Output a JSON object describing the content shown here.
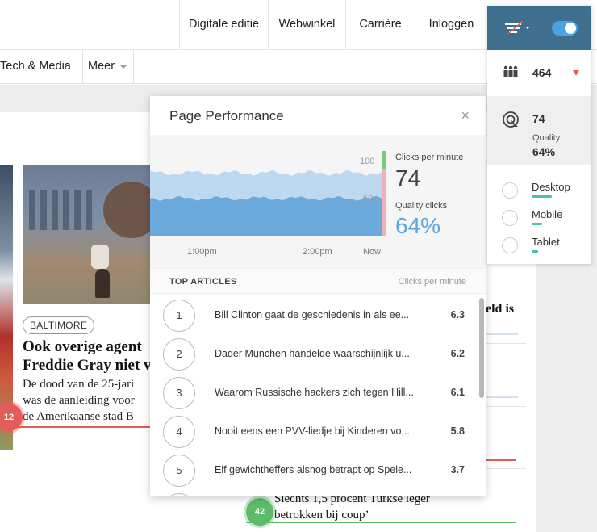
{
  "topnav": {
    "links": [
      "Digitale editie",
      "Webwinkel",
      "Carrière",
      "Inloggen"
    ]
  },
  "secnav": {
    "items": [
      "Tech & Media",
      "Meer"
    ]
  },
  "article": {
    "tag": "BALTIMORE",
    "headline_line1": "Ook overige agent",
    "headline_line2": "Freddie Gray niet v",
    "lede_line1": "De dood van de 25-jari",
    "lede_line2": "was de aanleiding voor",
    "lede_line3": "de Amerikaanse stad B",
    "badge": "12"
  },
  "bottom_article": {
    "line1": "Slechts 1,5 procent Turkse leger",
    "line2": "betrokken bij coup’",
    "badge": "42"
  },
  "side_fragments": {
    "frag1": "eld is"
  },
  "popup": {
    "title": "Page Performance",
    "close_icon": "×",
    "chart": {
      "axis_100": "100",
      "axis_50": "50",
      "time_labels": [
        "1:00pm",
        "2:00pm",
        "Now"
      ]
    },
    "cpm_label": "Clicks per minute",
    "cpm_value": "74",
    "qc_label": "Quality clicks",
    "qc_value": "64%",
    "top_articles_label": "TOP ARTICLES",
    "top_articles_metric": "Clicks per minute",
    "articles": [
      {
        "rank": "1",
        "title": "Bill Clinton gaat de geschiedenis in als ee...",
        "value": "6.3"
      },
      {
        "rank": "2",
        "title": "Dader München handelde waarschijnlijk u...",
        "value": "6.2"
      },
      {
        "rank": "3",
        "title": "Waarom Russische hackers zich tegen Hill...",
        "value": "6.1"
      },
      {
        "rank": "4",
        "title": "Nooit eens een PVV-liedje bij Kinderen vo...",
        "value": "5.8"
      },
      {
        "rank": "5",
        "title": "Elf gewichtheffers alsnog betrapt op Spele...",
        "value": "3.7"
      }
    ]
  },
  "panel": {
    "visitors": "464",
    "quality_value": "74",
    "quality_label": "Quality",
    "quality_pct": "64%",
    "devices": [
      {
        "label": "Desktop",
        "share": 0.55
      },
      {
        "label": "Mobile",
        "share": 0.28
      },
      {
        "label": "Tablet",
        "share": 0.17
      }
    ]
  },
  "colors": {
    "panel_header": "#3f6f8e",
    "toggle": "#4aa3e0",
    "chart_dark": "#6aa9da",
    "chart_light": "#bcd9ef",
    "accent_red": "#e45b5b",
    "accent_green": "#5dbb6a",
    "device_bar": "#4ec0b0"
  },
  "chart_data": {
    "type": "area",
    "x": [
      "1:00pm",
      "2:00pm",
      "Now"
    ],
    "series": [
      {
        "name": "Clicks per minute",
        "values": [
          74
        ]
      },
      {
        "name": "Quality clicks",
        "values": [
          64
        ]
      }
    ],
    "ylim": [
      0,
      100
    ],
    "yticks": [
      50,
      100
    ]
  }
}
